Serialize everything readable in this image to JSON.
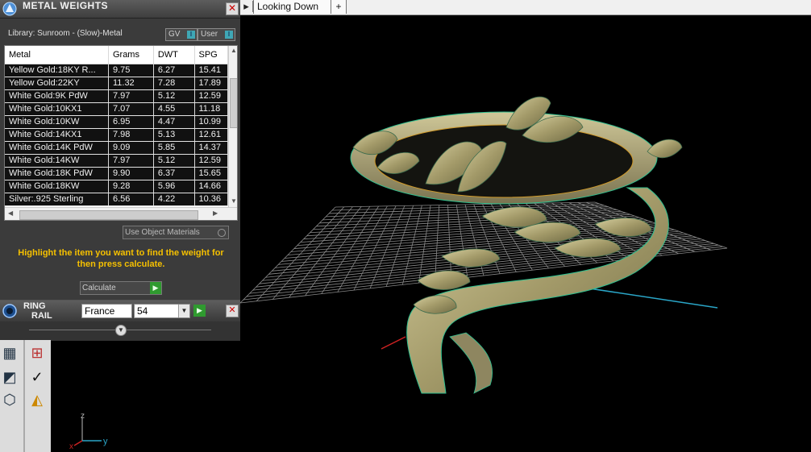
{
  "tabs": [
    {
      "label": "Looking Down"
    }
  ],
  "tab_add_icon": "+",
  "metal_weights": {
    "title": "METAL WEIGHTS",
    "close_glyph": "✕",
    "library": "Library: Sunroom - (Slow)-Metal",
    "toggle_gv": "GV",
    "toggle_user": "User",
    "columns": [
      "Metal",
      "Grams",
      "DWT",
      "SPG"
    ],
    "rows": [
      [
        "Yellow Gold:18KY R...",
        "9.75",
        "6.27",
        "15.41"
      ],
      [
        "Yellow Gold:22KY",
        "11.32",
        "7.28",
        "17.89"
      ],
      [
        "White Gold:9K PdW",
        "7.97",
        "5.12",
        "12.59"
      ],
      [
        "White Gold:10KX1",
        "7.07",
        "4.55",
        "11.18"
      ],
      [
        "White Gold:10KW",
        "6.95",
        "4.47",
        "10.99"
      ],
      [
        "White Gold:14KX1",
        "7.98",
        "5.13",
        "12.61"
      ],
      [
        "White Gold:14K PdW",
        "9.09",
        "5.85",
        "14.37"
      ],
      [
        "White Gold:14KW",
        "7.97",
        "5.12",
        "12.59"
      ],
      [
        "White Gold:18K PdW",
        "9.90",
        "6.37",
        "15.65"
      ],
      [
        "White Gold:18KW",
        "9.28",
        "5.96",
        "14.66"
      ],
      [
        "Silver:.925 Sterling",
        "6.56",
        "4.22",
        "10.36"
      ]
    ],
    "use_object_materials": "Use Object Materials",
    "highlight_message": "Highlight the item you want to find the weight for then press calculate.",
    "calculate_label": "Calculate"
  },
  "ring_rail": {
    "title_line1": "RING",
    "title_line2": "RAIL",
    "country": "France",
    "size": "54"
  },
  "axis": {
    "x": "x",
    "y": "y",
    "z": "z"
  },
  "colors": {
    "panel_bg": "#3b3b3b",
    "highlight_text": "#f5c000",
    "go_button": "#2f9a2f",
    "ring_metal": "#b7ae7d",
    "grid": "#8a8a8a",
    "ring_outline": "#2fbf8f"
  },
  "icons": [
    "app-logo-icon",
    "close-icon",
    "go-arrow-icon",
    "dropdown-icon",
    "grid-icon",
    "check-icon",
    "cube-icon",
    "paint-icon"
  ]
}
